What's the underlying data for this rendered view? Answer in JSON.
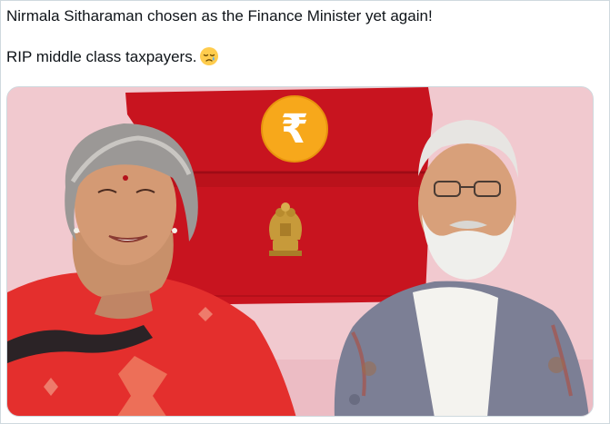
{
  "tweet": {
    "line1": "Nirmala Sitharaman chosen as the Finance Minister yet again!",
    "line2": "RIP middle class taxpayers.",
    "emoji": "crying-face-emoji"
  },
  "media": {
    "badge_symbol": "₹",
    "colors": {
      "background": "#f1c9cf",
      "briefcase": "#c8141f",
      "badge": "#f7a81b",
      "emblem": "#c79a3a",
      "saree": "#e42f2d",
      "shawl": "#7c7f95"
    }
  }
}
